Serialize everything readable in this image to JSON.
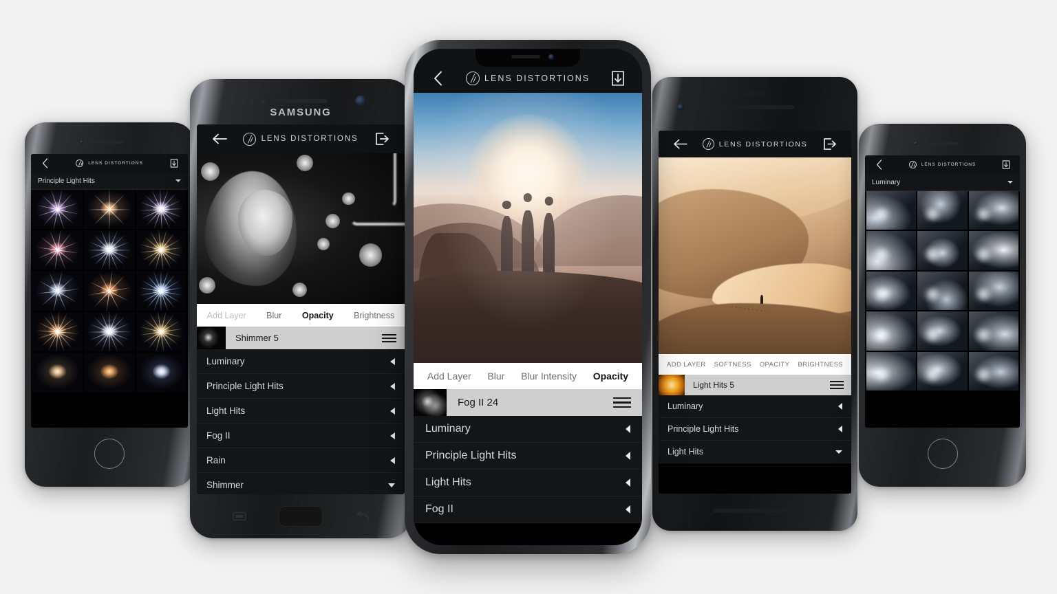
{
  "page": {
    "background_color": "#f2f2f2",
    "app_name": "LENS DISTORTIONS",
    "wordmark": "LENS DISTORTIONS"
  },
  "phones": [
    {
      "id": "phone-left",
      "device": "iPhone 7 Space Gray",
      "screen_type": "preset-grid",
      "header": {
        "back_icon": "chevron-left-icon",
        "brand": "LENS DISTORTIONS",
        "action_icon": "export-download-icon"
      },
      "dropdown": {
        "label": "Principle Light Hits",
        "caret_icon": "caret-down-icon"
      },
      "grid_title": "Principle Light Hits presets",
      "thumbnails": [
        {
          "name": "preset-1",
          "core": "#f2e7ff",
          "halo": "#b79ad8",
          "glow": "#6e5f8a",
          "rays": 6,
          "rot": 12
        },
        {
          "name": "preset-2",
          "core": "#ffe9cf",
          "halo": "#e0a877",
          "glow": "#8a6a49",
          "rays": 4,
          "rot": 0
        },
        {
          "name": "preset-3",
          "core": "#ffffff",
          "halo": "#d8c6ee",
          "glow": "#6a5e86",
          "rays": 8,
          "rot": 20
        },
        {
          "name": "preset-4",
          "core": "#fff0d2",
          "halo": "#d8849c",
          "glow": "#7d4f5e",
          "rays": 6,
          "rot": 8
        },
        {
          "name": "preset-5",
          "core": "#ffffff",
          "halo": "#cfd9ef",
          "glow": "#4c5b7c",
          "rays": 8,
          "rot": 0
        },
        {
          "name": "preset-6",
          "core": "#fff3cf",
          "halo": "#d9b26a",
          "glow": "#7e6637",
          "rays": 8,
          "rot": 16
        },
        {
          "name": "preset-7",
          "core": "#ffffff",
          "halo": "#b8c6e4",
          "glow": "#4a5570",
          "rays": 5,
          "rot": 30
        },
        {
          "name": "preset-8",
          "core": "#ffd9a8",
          "halo": "#e0915a",
          "glow": "#8c5a33",
          "rays": 5,
          "rot": 26
        },
        {
          "name": "preset-9",
          "core": "#ffffff",
          "halo": "#9fc1ee",
          "glow": "#3d5d8c",
          "rays": 9,
          "rot": 10
        },
        {
          "name": "preset-10",
          "core": "#ffe6b8",
          "halo": "#e2a05e",
          "glow": "#8e5f30",
          "rays": 8,
          "rot": 4
        },
        {
          "name": "preset-11",
          "core": "#ffffff",
          "halo": "#cdd6ea",
          "glow": "#55607c",
          "rays": 8,
          "rot": 22
        },
        {
          "name": "preset-12",
          "core": "#fff1c8",
          "halo": "#dbb36b",
          "glow": "#7d6538",
          "rays": 8,
          "rot": 14
        },
        {
          "name": "preset-13",
          "core": "#fff4dd",
          "halo": "#d7b488",
          "glow": "#6d5a43",
          "rays": 0,
          "rot": 0
        },
        {
          "name": "preset-14",
          "core": "#ffe1b4",
          "halo": "#d99a5e",
          "glow": "#7a5632",
          "rays": 0,
          "rot": 0
        },
        {
          "name": "preset-15",
          "core": "#ffffff",
          "halo": "#c9d4ea",
          "glow": "#4f5b78",
          "rays": 0,
          "rot": 0
        }
      ]
    },
    {
      "id": "phone-samsung",
      "device": "Samsung Galaxy S7 edge",
      "brand_text": "SAMSUNG",
      "screen_type": "editor",
      "header": {
        "back_icon": "arrow-left-icon",
        "brand": "LENS DISTORTIONS",
        "action_icon": "export-arrow-icon"
      },
      "photo": {
        "name": "black-and-white-portrait",
        "description": "Woman in profile with neon bokeh"
      },
      "tabs": [
        {
          "label": "Add Layer",
          "state": "dim"
        },
        {
          "label": "Blur",
          "state": "normal"
        },
        {
          "label": "Opacity",
          "state": "active"
        },
        {
          "label": "Brightness",
          "state": "normal"
        }
      ],
      "layer": {
        "name": "Shimmer 5",
        "thumbnail": "shimmer-texture",
        "handle_icon": "drag-handle-icon"
      },
      "effects": [
        {
          "label": "Luminary",
          "chevron": "chevron-left-icon"
        },
        {
          "label": "Principle Light Hits",
          "chevron": "chevron-left-icon"
        },
        {
          "label": "Light Hits",
          "chevron": "chevron-left-icon"
        },
        {
          "label": "Fog II",
          "chevron": "chevron-left-icon"
        },
        {
          "label": "Rain",
          "chevron": "chevron-left-icon"
        },
        {
          "label": "Shimmer",
          "chevron": "caret-down-icon"
        }
      ],
      "nav": {
        "recents_icon": "recents-square-icon",
        "home_button": "home-button",
        "back_icon": "back-arrow-icon"
      }
    },
    {
      "id": "phone-center",
      "device": "iPhone X",
      "screen_type": "editor",
      "header": {
        "back_icon": "chevron-left-icon",
        "brand": "LENS DISTORTIONS",
        "action_icon": "export-download-icon"
      },
      "photo": {
        "name": "desert-sunset-silhouettes",
        "description": "Three figures silhouetted on a ridge at hazy sunset"
      },
      "tabs": [
        {
          "label": "Add Layer",
          "state": "normal"
        },
        {
          "label": "Blur",
          "state": "normal"
        },
        {
          "label": "Blur Intensity",
          "state": "normal"
        },
        {
          "label": "Opacity",
          "state": "active"
        }
      ],
      "layer": {
        "name": "Fog II 24",
        "thumbnail": "fog-texture",
        "handle_icon": "drag-handle-icon"
      },
      "effects": [
        {
          "label": "Luminary",
          "chevron": "chevron-left-icon"
        },
        {
          "label": "Principle Light Hits",
          "chevron": "chevron-left-icon"
        },
        {
          "label": "Light Hits",
          "chevron": "chevron-left-icon"
        },
        {
          "label": "Fog II",
          "chevron": "chevron-left-icon"
        }
      ]
    },
    {
      "id": "phone-pixel",
      "device": "Google Pixel 2 Black",
      "screen_type": "editor",
      "header": {
        "back_icon": "arrow-left-icon",
        "brand": "LENS DISTORTIONS",
        "action_icon": "export-arrow-icon"
      },
      "photo": {
        "name": "desert-dunes-lone-walker",
        "description": "Sand dunes at golden hour with a lone figure and footprints"
      },
      "tabs": [
        {
          "label": "ADD LAYER",
          "state": "normal"
        },
        {
          "label": "SOFTNESS",
          "state": "normal"
        },
        {
          "label": "OPACITY",
          "state": "normal"
        },
        {
          "label": "BRIGHTNESS",
          "state": "normal"
        }
      ],
      "layer": {
        "name": "Light Hits 5",
        "thumbnail": "warm-glow-texture",
        "handle_icon": "drag-handle-icon"
      },
      "effects": [
        {
          "label": "Luminary",
          "chevron": "chevron-left-icon"
        },
        {
          "label": "Principle Light Hits",
          "chevron": "chevron-left-icon"
        },
        {
          "label": "Light Hits",
          "chevron": "caret-down-icon"
        }
      ]
    },
    {
      "id": "phone-right",
      "device": "iPhone 7 Space Gray",
      "screen_type": "preset-grid",
      "header": {
        "back_icon": "chevron-left-icon",
        "brand": "LENS DISTORTIONS",
        "action_icon": "export-download-icon"
      },
      "dropdown": {
        "label": "Luminary",
        "caret_icon": "caret-down-icon"
      },
      "grid_title": "Luminary presets",
      "thumbnails": [
        {
          "name": "lum-1",
          "tint": "#cfd8e2",
          "spot": "18% 70%",
          "size": 64
        },
        {
          "name": "lum-2",
          "tint": "#c2ccd8",
          "spot": "46% 34%",
          "size": 54
        },
        {
          "name": "lum-3",
          "tint": "#d7dde4",
          "spot": "66% 44%",
          "size": 58
        },
        {
          "name": "lum-4",
          "tint": "#e4e9ee",
          "spot": "22% 78%",
          "size": 72
        },
        {
          "name": "lum-5",
          "tint": "#cdd5de",
          "spot": "50% 56%",
          "size": 50
        },
        {
          "name": "lum-6",
          "tint": "#eef2f6",
          "spot": "70% 48%",
          "size": 66
        },
        {
          "name": "lum-7",
          "tint": "#dbe2ea",
          "spot": "36% 56%",
          "size": 60
        },
        {
          "name": "lum-8",
          "tint": "#b9c4d2",
          "spot": "58% 72%",
          "size": 52
        },
        {
          "name": "lum-9",
          "tint": "#c6d0dc",
          "spot": "62% 40%",
          "size": 62
        },
        {
          "name": "lum-10",
          "tint": "#e9eef3",
          "spot": "28% 62%",
          "size": 70
        },
        {
          "name": "lum-11",
          "tint": "#cbd4de",
          "spot": "44% 50%",
          "size": 56
        },
        {
          "name": "lum-12",
          "tint": "#d2dae3",
          "spot": "72% 58%",
          "size": 64
        },
        {
          "name": "lum-13",
          "tint": "#eaeff4",
          "spot": "20% 54%",
          "size": 74
        },
        {
          "name": "lum-14",
          "tint": "#dde4eb",
          "spot": "40% 46%",
          "size": 58
        },
        {
          "name": "lum-15",
          "tint": "#c4cedb",
          "spot": "64% 52%",
          "size": 60
        }
      ]
    }
  ]
}
